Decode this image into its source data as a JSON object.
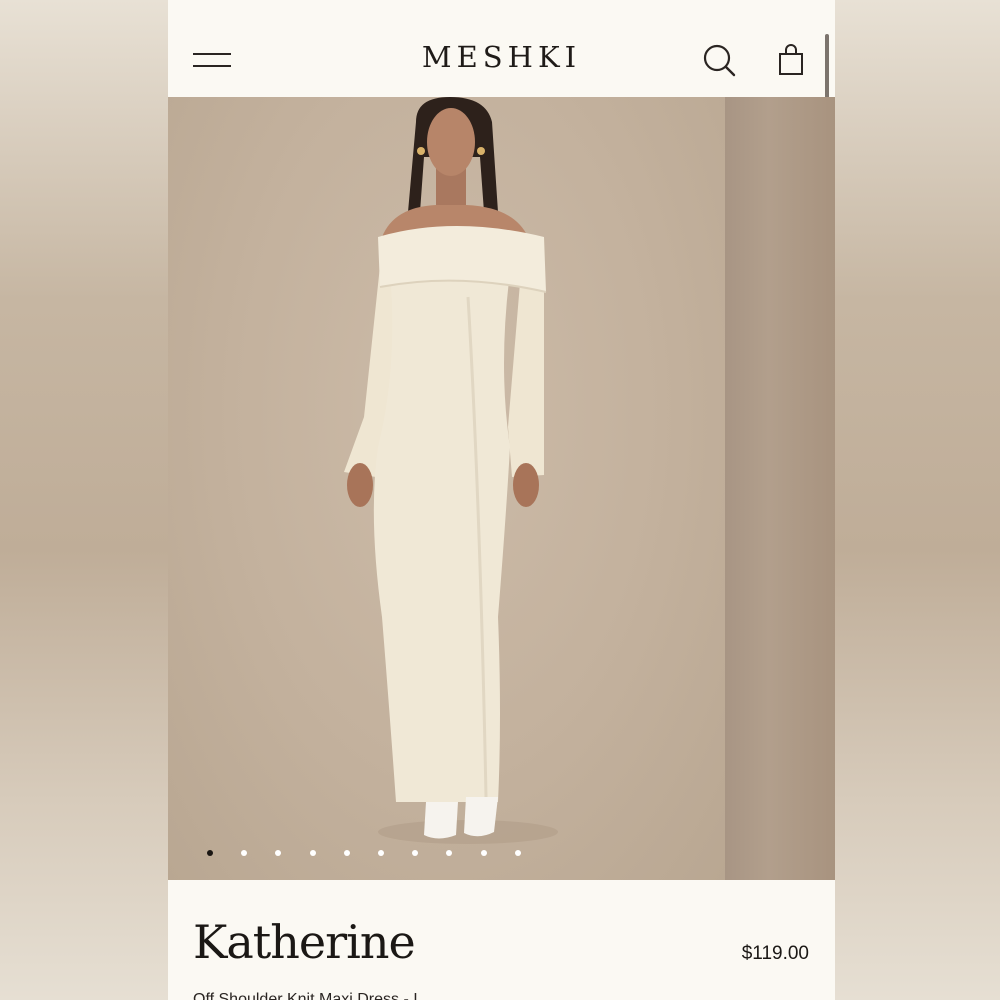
{
  "header": {
    "brand": "MESHKI",
    "menu_icon": "hamburger-menu-icon",
    "search_icon": "search-icon",
    "bag_icon": "shopping-bag-icon"
  },
  "gallery": {
    "slide_count": 10,
    "active_index": 0
  },
  "product": {
    "name": "Katherine",
    "price": "$119.00",
    "subtitle": "Off Shoulder Knit Maxi Dress - I"
  },
  "colors": {
    "page_bg": "#fbf9f3",
    "text": "#1b1815",
    "photo_bg": "#c6b4a0",
    "dress": "#f0e8d6"
  }
}
